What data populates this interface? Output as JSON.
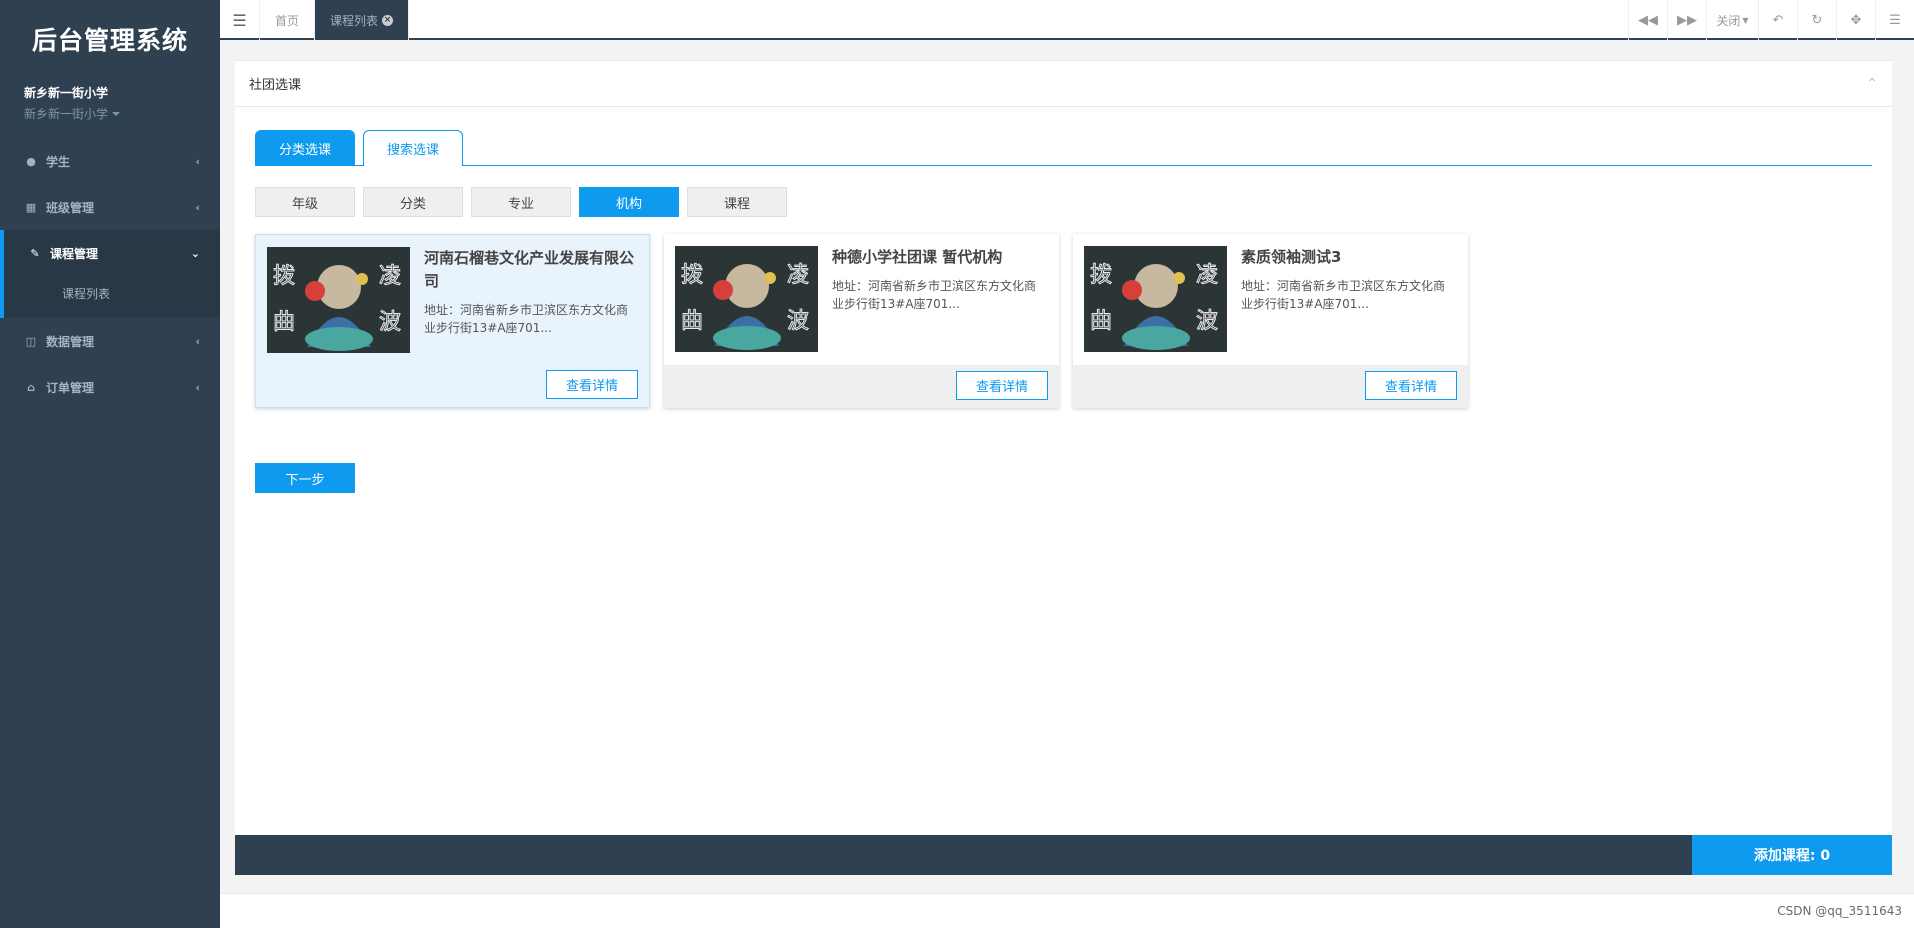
{
  "sidebar": {
    "brand": "后台管理系统",
    "user_name": "新乡新一街小学",
    "user_org": "新乡新一街小学",
    "items": [
      {
        "label": "学生",
        "icon": "user-icon"
      },
      {
        "label": "班级管理",
        "icon": "calculator-icon"
      },
      {
        "label": "课程管理",
        "icon": "edit-icon"
      },
      {
        "label": "数据管理",
        "icon": "map-icon"
      },
      {
        "label": "订单管理",
        "icon": "bank-icon"
      }
    ],
    "sub_items": [
      {
        "label": "课程列表"
      }
    ]
  },
  "topbar": {
    "tabs": [
      {
        "label": "首页"
      },
      {
        "label": "课程列表"
      }
    ],
    "close_label": "关闭"
  },
  "panel": {
    "title": "社团选课",
    "mode_tabs": [
      {
        "label": "分类选课"
      },
      {
        "label": "搜索选课"
      }
    ],
    "filters": [
      {
        "label": "年级"
      },
      {
        "label": "分类"
      },
      {
        "label": "专业"
      },
      {
        "label": "机构"
      },
      {
        "label": "课程"
      }
    ],
    "active_filter": "机构",
    "cards": [
      {
        "title": "河南石榴巷文化产业发展有限公司",
        "address": "地址：河南省新乡市卫滨区东方文化商业步行街13#A座701...",
        "button": "查看详情"
      },
      {
        "title": "种德小学社团课 暂代机构",
        "address": "地址：河南省新乡市卫滨区东方文化商业步行街13#A座701...",
        "button": "查看详情"
      },
      {
        "title": "素质领袖测试3",
        "address": "地址：河南省新乡市卫滨区东方文化商业步行街13#A座701...",
        "button": "查看详情"
      }
    ],
    "next_label": "下一步",
    "add_count": "添加课程: 0"
  },
  "footer": {
    "copyright": "CSDN @qq_3511643"
  },
  "colors": {
    "sidebar": "#2f4050",
    "accent": "#0e9aef"
  }
}
